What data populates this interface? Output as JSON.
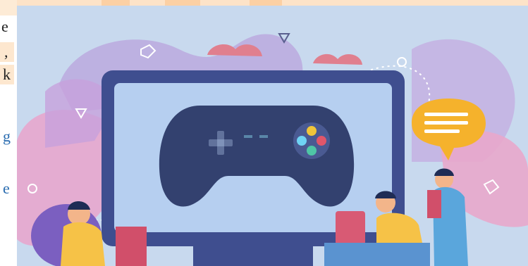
{
  "left_fragments": [
    {
      "text": "e",
      "style": "dark"
    },
    {
      "text": ",",
      "style": "dark"
    },
    {
      "text": "k",
      "style": "dark"
    },
    {
      "text": "g",
      "style": "link"
    },
    {
      "text": "e",
      "style": "link"
    }
  ],
  "illustration": {
    "subject": "gamepad-on-monitor",
    "colors": {
      "background": "#c5d7ee",
      "monitor_frame": "#3d4d8c",
      "screen": "#b6cfef",
      "gamepad": "#324272",
      "speech_bubble": "#f5b22c",
      "blob_pink": "#e9a8cf",
      "blob_purple": "#b39ad6"
    }
  }
}
